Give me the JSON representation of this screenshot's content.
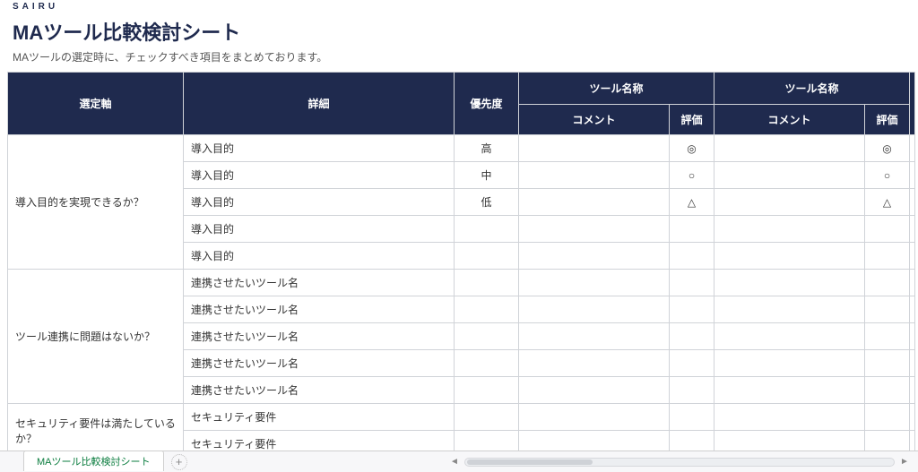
{
  "header": {
    "brand": "SAIRU",
    "title": "MAツール比較検討シート",
    "subtitle": "MAツールの選定時に、チェックすべき項目をまとめております。"
  },
  "columns": {
    "axis": "選定軸",
    "detail": "詳細",
    "priority": "優先度",
    "tool_a": "ツール名称",
    "tool_b": "ツール名称",
    "comment": "コメント",
    "score": "評価"
  },
  "groups": [
    {
      "axis": "導入目的を実現できるか？",
      "rows": [
        {
          "detail": "導入目的",
          "priority": "高",
          "score_a": "◎",
          "score_b": "◎"
        },
        {
          "detail": "導入目的",
          "priority": "中",
          "score_a": "○",
          "score_b": "○"
        },
        {
          "detail": "導入目的",
          "priority": "低",
          "score_a": "△",
          "score_b": "△"
        },
        {
          "detail": "導入目的",
          "priority": "",
          "score_a": "",
          "score_b": ""
        },
        {
          "detail": "導入目的",
          "priority": "",
          "score_a": "",
          "score_b": ""
        }
      ]
    },
    {
      "axis": "ツール連携に問題はないか？",
      "rows": [
        {
          "detail": "連携させたいツール名",
          "priority": "",
          "score_a": "",
          "score_b": ""
        },
        {
          "detail": "連携させたいツール名",
          "priority": "",
          "score_a": "",
          "score_b": ""
        },
        {
          "detail": "連携させたいツール名",
          "priority": "",
          "score_a": "",
          "score_b": ""
        },
        {
          "detail": "連携させたいツール名",
          "priority": "",
          "score_a": "",
          "score_b": ""
        },
        {
          "detail": "連携させたいツール名",
          "priority": "",
          "score_a": "",
          "score_b": ""
        }
      ]
    },
    {
      "axis": "セキュリティ要件は満たしているか？",
      "rows": [
        {
          "detail": "セキュリティ要件",
          "priority": "",
          "score_a": "",
          "score_b": ""
        },
        {
          "detail": "セキュリティ要件",
          "priority": "",
          "score_a": "",
          "score_b": ""
        }
      ]
    }
  ],
  "tabbar": {
    "tab": "MAツール比較検討シート",
    "add": "+"
  },
  "icons": {
    "arrow_left": "◄",
    "arrow_right": "►"
  }
}
